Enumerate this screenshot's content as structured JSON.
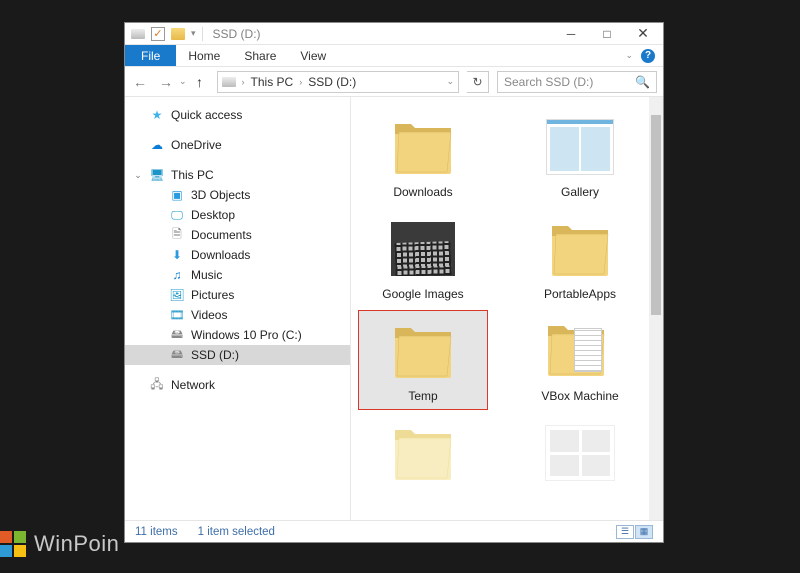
{
  "title": "SSD (D:)",
  "ribbon": {
    "file": "File",
    "tabs": [
      "Home",
      "Share",
      "View"
    ]
  },
  "breadcrumb": [
    "This PC",
    "SSD (D:)"
  ],
  "search": {
    "placeholder": "Search SSD (D:)"
  },
  "navpane": {
    "quick_access": "Quick access",
    "onedrive": "OneDrive",
    "this_pc": "This PC",
    "children": [
      "3D Objects",
      "Desktop",
      "Documents",
      "Downloads",
      "Music",
      "Pictures",
      "Videos",
      "Windows 10 Pro (C:)",
      "SSD (D:)"
    ],
    "network": "Network"
  },
  "items": [
    {
      "label": "Downloads",
      "kind": "folder"
    },
    {
      "label": "Gallery",
      "kind": "folder-thumb"
    },
    {
      "label": "Google Images",
      "kind": "folder-photo"
    },
    {
      "label": "PortableApps",
      "kind": "folder"
    },
    {
      "label": "Temp",
      "kind": "folder",
      "selected": true
    },
    {
      "label": "VBox Machine",
      "kind": "folder-vbox"
    },
    {
      "label": "",
      "kind": "folder-light"
    },
    {
      "label": "",
      "kind": "paper"
    }
  ],
  "statusbar": {
    "count": "11 items",
    "selection": "1 item selected"
  },
  "watermark": "WinPoin"
}
